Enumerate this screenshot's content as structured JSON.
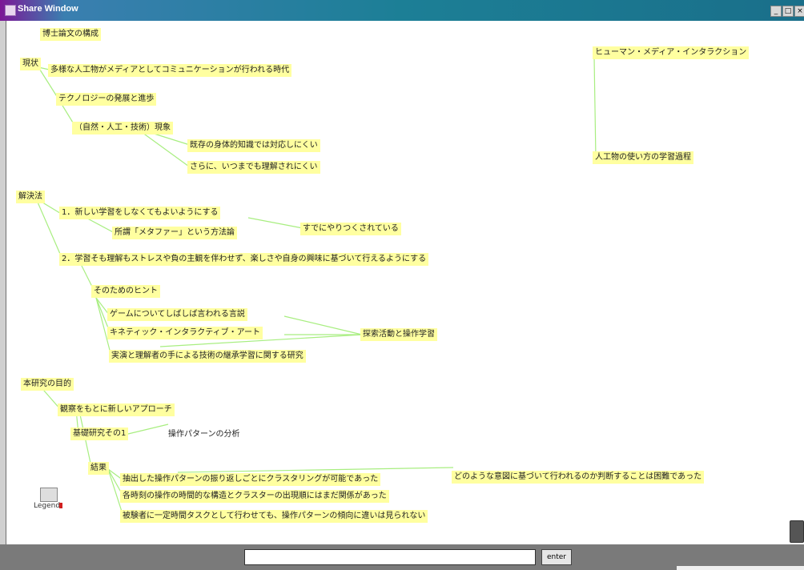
{
  "window": {
    "title": "Share Window",
    "min": "_",
    "max": "□",
    "close": "×"
  },
  "nodes": {
    "n1": "博士論文の構成",
    "n2": "現状",
    "n3": "多様な人工物がメディアとしてコミュニケーションが行われる時代",
    "n4": "テクノロジーの発展と進歩",
    "n5": "（自然・人工・技術）現象",
    "n6": "既存の身体的知識では対応しにくい",
    "n7": "さらに、いつまでも理解されにくい",
    "n8": "ヒューマン・メディア・インタラクション",
    "n9": "人工物の使い方の学習過程",
    "n10": "解決法",
    "n11": "1．新しい学習をしなくてもよいようにする",
    "n12": "所謂「メタファー」という方法論",
    "n13": "すでにやりつくされている",
    "n14": "2．学習そも理解もストレスや負の主観を伴わせず、楽しさや自身の興味に基づいて行えるようにする",
    "n15": "そのためのヒント",
    "n16": "ゲームについてしばしば言われる言説",
    "n17": "キネティック・インタラクティブ・アート",
    "n18": "探索活動と操作学習",
    "n19": "実演と理解者の手による技術の継承学習に関する研究",
    "n20": "本研究の目的",
    "n21": "観察をもとに新しいアプローチ",
    "n22": "基礎研究その1",
    "n23": "操作パターンの分析",
    "n24": "結果",
    "n25": "抽出した操作パターンの振り返しごとにクラスタリングが可能であった",
    "n26": "どのような意図に基づいて行われるのか判断することは困難であった",
    "n27": "各時刻の操作の時間的な構造とクラスターの出現順にはまだ関係があった",
    "n28": "被験者に一定時間タスクとして行わせても、操作パターンの傾向に違いは見られない"
  },
  "legend": {
    "label": "Legend"
  },
  "chat": {
    "placeholder": "",
    "value": "",
    "enter_label": "enter"
  }
}
